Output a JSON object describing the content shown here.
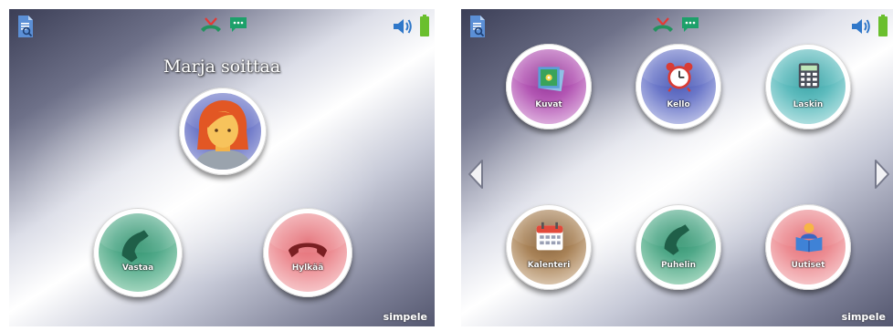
{
  "screen_incoming": {
    "caller_name": "Marja soittaa",
    "answer_label": "Vastaa",
    "reject_label": "Hylkää",
    "brand": "simpele"
  },
  "screen_home": {
    "apps": [
      {
        "label": "Kuvat",
        "icon": "photos-icon",
        "color": "#a94aa9"
      },
      {
        "label": "Kello",
        "icon": "alarm-clock-icon",
        "color": "#5562bf"
      },
      {
        "label": "Laskin",
        "icon": "calculator-icon",
        "color": "#4fb2b4"
      },
      {
        "label": "Kalenteri",
        "icon": "calendar-icon",
        "color": "#9a7448"
      },
      {
        "label": "Puhelin",
        "icon": "phone-icon",
        "color": "#43a07f"
      },
      {
        "label": "Uutiset",
        "icon": "news-reader-icon",
        "color": "#e4757c"
      }
    ],
    "brand": "simpele"
  },
  "status_bar": {
    "icons": [
      "document-search-icon",
      "missed-call-icon",
      "message-icon",
      "speaker-icon",
      "battery-icon"
    ],
    "battery_color": "#6abf2e"
  }
}
